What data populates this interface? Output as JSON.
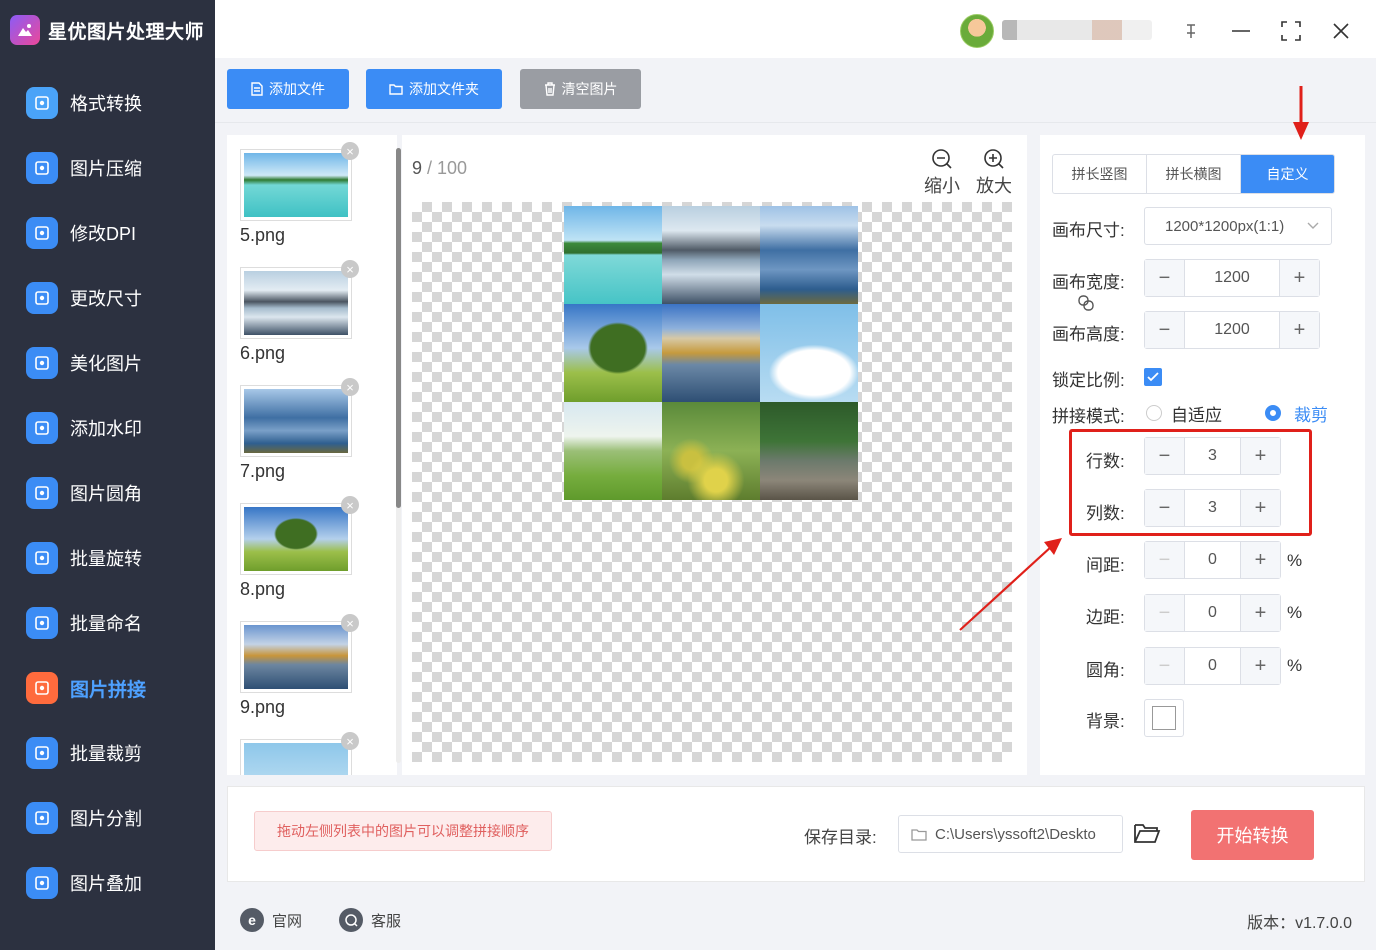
{
  "app": {
    "title": "星优图片处理大师"
  },
  "sidebar": {
    "items": [
      {
        "label": "格式转换",
        "color": "#4aa3f8"
      },
      {
        "label": "图片压缩",
        "color": "#3b8cf5"
      },
      {
        "label": "修改DPI",
        "color": "#3b8cf5"
      },
      {
        "label": "更改尺寸",
        "color": "#3b8cf5"
      },
      {
        "label": "美化图片",
        "color": "#3b8cf5"
      },
      {
        "label": "添加水印",
        "color": "#3b8cf5"
      },
      {
        "label": "图片圆角",
        "color": "#3b8cf5"
      },
      {
        "label": "批量旋转",
        "color": "#3b8cf5"
      },
      {
        "label": "批量命名",
        "color": "#3b8cf5"
      },
      {
        "label": "图片拼接",
        "color": "#ff6b3d"
      },
      {
        "label": "批量裁剪",
        "color": "#3b8cf5"
      },
      {
        "label": "图片分割",
        "color": "#3b8cf5"
      },
      {
        "label": "图片叠加",
        "color": "#3b8cf5"
      }
    ],
    "active_index": 9
  },
  "toolbar": {
    "add_file": "添加文件",
    "add_folder": "添加文件夹",
    "clear_images": "清空图片"
  },
  "thumbnails": [
    {
      "name": "5.png",
      "scene": "beach"
    },
    {
      "name": "6.png",
      "scene": "lake-mountain"
    },
    {
      "name": "7.png",
      "scene": "blue-mountains"
    },
    {
      "name": "8.png",
      "scene": "tree-field"
    },
    {
      "name": "9.png",
      "scene": "autumn-lake"
    },
    {
      "name": "",
      "scene": "sky"
    }
  ],
  "preview": {
    "current_page": "9",
    "separator": " / ",
    "total_pages": "100",
    "zoom_out": "缩小",
    "zoom_in": "放大"
  },
  "settings": {
    "tabs": [
      "拼长竖图",
      "拼长横图",
      "自定义"
    ],
    "active_tab": 2,
    "canvas_size_label": "画布尺寸:",
    "canvas_size_value": "1200*1200px(1:1)",
    "canvas_width_label": "画布宽度:",
    "canvas_width": "1200",
    "canvas_height_label": "画布高度:",
    "canvas_height": "1200",
    "lock_ratio_label": "锁定比例:",
    "lock_ratio": true,
    "mode_label": "拼接模式:",
    "mode_adapt": "自适应",
    "mode_crop": "裁剪",
    "rows_label": "行数:",
    "rows": "3",
    "cols_label": "列数:",
    "cols": "3",
    "spacing_label": "间距:",
    "spacing": "0",
    "margin_label": "边距:",
    "margin": "0",
    "radius_label": "圆角:",
    "radius": "0",
    "percent": "%",
    "background_label": "背景:",
    "background_color": "#ffffff"
  },
  "bottom": {
    "hint": "拖动左侧列表中的图片可以调整拼接顺序",
    "save_label": "保存目录:",
    "save_path": "C:\\Users\\yssoft2\\Deskto",
    "start_button": "开始转换"
  },
  "footer": {
    "website": "官网",
    "support": "客服",
    "version": "版本：v1.7.0.0"
  },
  "colors": {
    "accent": "#3b8cf5",
    "start": "#f27272",
    "annotation": "#e0201a"
  }
}
